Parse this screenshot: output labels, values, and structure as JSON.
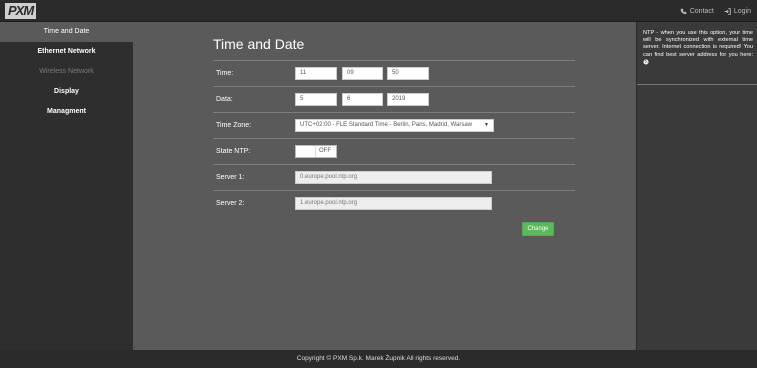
{
  "brand": {
    "logo_text": "PXM"
  },
  "topbar": {
    "contact_label": "Contact",
    "login_label": "Login"
  },
  "sidebar": {
    "items": [
      {
        "label": "Time and Date"
      },
      {
        "label": "Ethernet Network"
      },
      {
        "label": "Wireless Network"
      },
      {
        "label": "Display"
      },
      {
        "label": "Managment"
      }
    ]
  },
  "main": {
    "title": "Time and Date",
    "time": {
      "label": "Time:",
      "hour": "11",
      "minute": "09",
      "second": "50"
    },
    "date": {
      "label": "Data:",
      "day": "5",
      "month": "6",
      "year": "2019"
    },
    "timezone": {
      "label": "Time Zone:",
      "value": "UTC+02:00 - FLE Standard Time - Berlin, Paris, Madrid, Warsaw"
    },
    "ntp": {
      "label": "State NTP:",
      "value": "OFF"
    },
    "server1": {
      "label": "Server 1:",
      "value": "0.europe.pool.ntp.org"
    },
    "server2": {
      "label": "Server 2:",
      "value": "1.europe.pool.ntp.org"
    },
    "change_label": "Change"
  },
  "help": {
    "text": "NTP - when you use this option, your time will be synchronized with external time server. Internet connection is required! You can find best server address for you here:"
  },
  "footer": {
    "copyright": "Copyright © PXM Sp.k. Marek Żupnik All rights reserved."
  },
  "colors": {
    "accent_green": "#5cb85c",
    "sidebar_bg": "#2e2e2e",
    "main_bg": "#5a5a5a",
    "topbar_bg": "#2b2b2b"
  }
}
